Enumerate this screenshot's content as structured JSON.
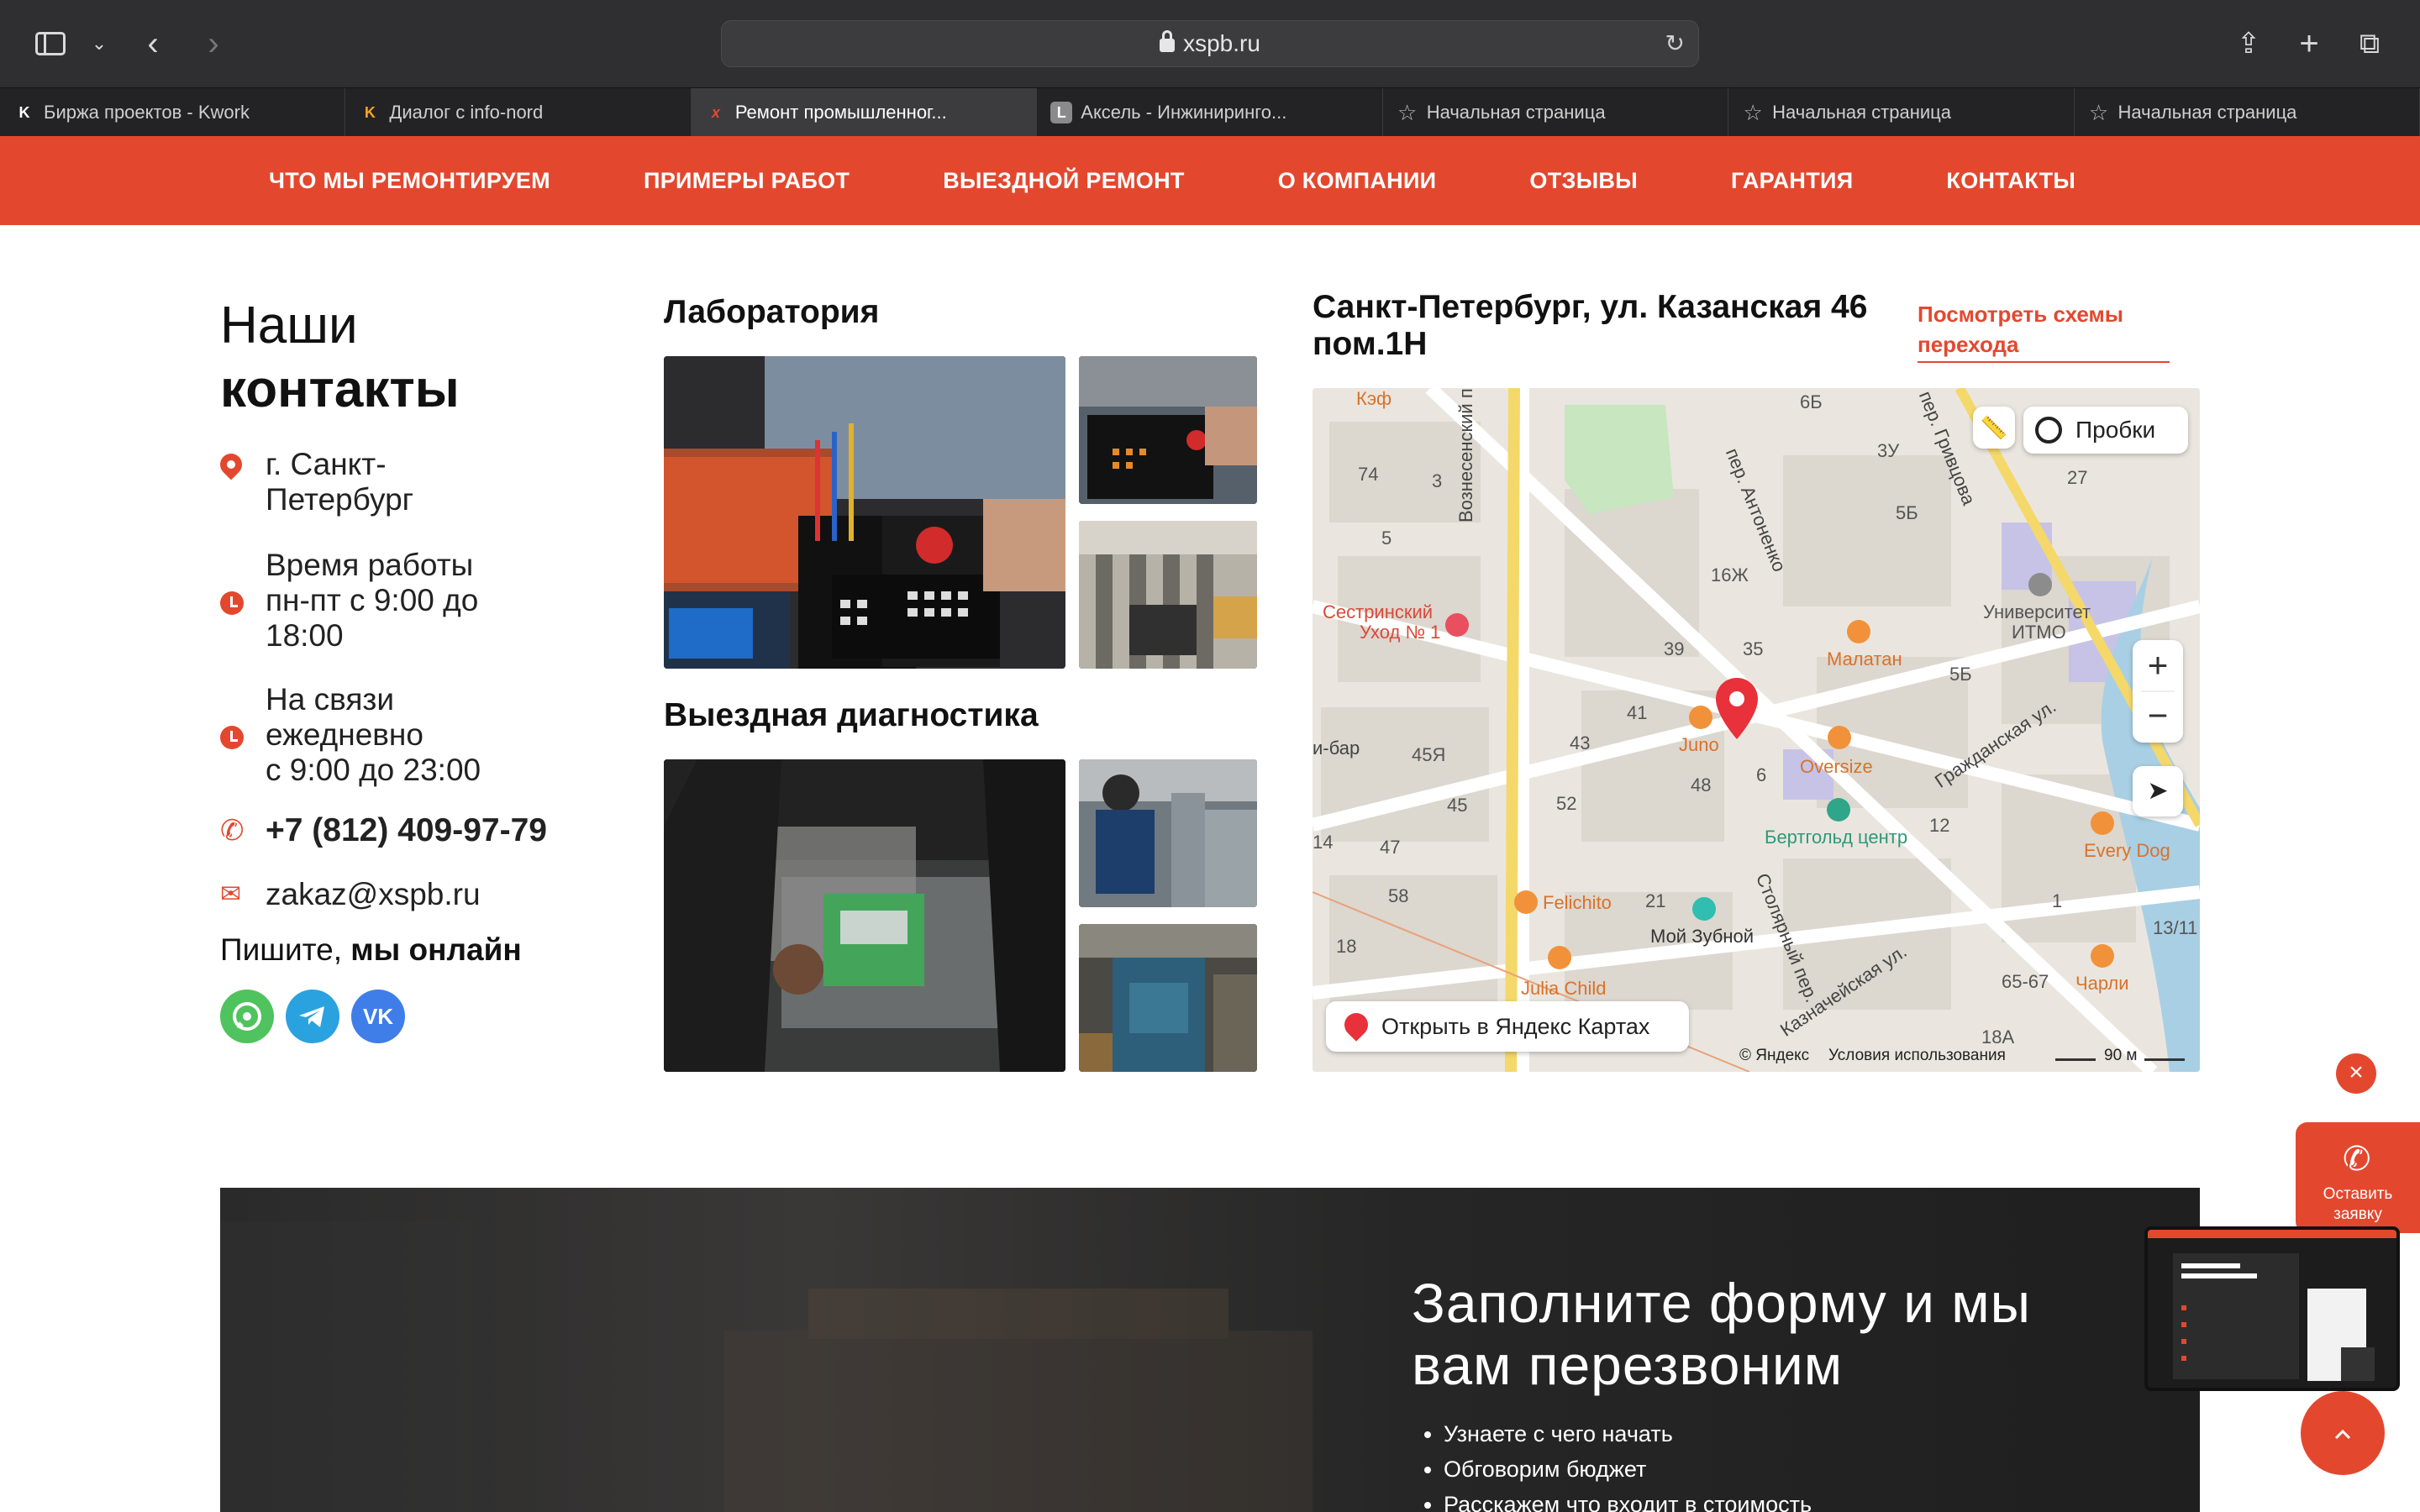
{
  "browser": {
    "url": "xspb.ru",
    "tabs": [
      {
        "label": "Биржа проектов - Kwork",
        "fav": "K"
      },
      {
        "label": "Диалог с info-nord",
        "fav": "K"
      },
      {
        "label": "Ремонт промышленног...",
        "fav": "x"
      },
      {
        "label": "Аксель - Инжиниринго...",
        "fav": "L"
      },
      {
        "label": "Начальная страница",
        "fav": "☆"
      },
      {
        "label": "Начальная страница",
        "fav": "☆"
      },
      {
        "label": "Начальная страница",
        "fav": "☆"
      }
    ]
  },
  "nav": [
    "ЧТО МЫ РЕМОНТИРУЕМ",
    "ПРИМЕРЫ РАБОТ",
    "ВЫЕЗДНОЙ РЕМОНТ",
    "О КОМПАНИИ",
    "ОТЗЫВЫ",
    "ГАРАНТИЯ",
    "КОНТАКТЫ"
  ],
  "contacts": {
    "title_light": "Наши",
    "title_bold": "контакты",
    "city": "г. Санкт-Петербург",
    "hours_title": "Время работы",
    "hours": "пн-пт с 9:00 до 18:00",
    "online_title": "На связи ежедневно",
    "online_hours": "с 9:00 до 23:00",
    "phone": "+7 (812) 409-97-79",
    "email": "zakaz@xspb.ru",
    "write_light": "Пишите,",
    "write_bold": "мы онлайн"
  },
  "gallery": {
    "lab_title": "Лаборатория",
    "field_title": "Выездная диагностика"
  },
  "map": {
    "address": "Санкт-Петербург, ул. Казанская 46 пом.1Н",
    "schemes_link": "Посмотреть схемы перехода",
    "traffic": "Пробки",
    "open_yandex": "Открыть в Яндекс Картах",
    "copyright": "© Яндекс",
    "terms": "Условия использования",
    "scale": "90 м",
    "labels": {
      "kef": "Кэф",
      "sestr": "Сестринский",
      "uhod": "Уход № 1",
      "vozn": "Вознесенский просп.",
      "antonenko": "пер. Антоненко",
      "grivcova": "пер. Гривцова",
      "univer": "Университет",
      "itmo": "ИТМО",
      "malatan": "Малатан",
      "juno": "Juno",
      "oversize": "Oversize",
      "bertgold": "Бертгольд центр",
      "everydog": "Every Dog",
      "felichito": "Felichito",
      "zubnoy": "Мой Зубной",
      "julia": "Julia Child",
      "charli": "Чарли",
      "grazhd": "Гражданская ул.",
      "stolyar": "Столярный пер.",
      "kaznach": "Казначейская ул.",
      "bar": "и-бар",
      "n16": "16Ж",
      "n35": "35",
      "n39": "39",
      "n41": "41",
      "n43": "43",
      "n48": "48",
      "n52": "52",
      "n45": "45",
      "n47": "47",
      "n459": "45Я",
      "n58": "58",
      "n21": "21",
      "n14": "14",
      "n18": "18",
      "n6": "6",
      "n5b": "5Б",
      "n1": "1",
      "n13": "13/11",
      "n65": "65-67",
      "n18a": "18А",
      "n74": "74",
      "n3": "3",
      "n5": "5",
      "n27": "27",
      "n3u": "3У",
      "n6b": "6Б",
      "n5b2": "5Б",
      "n12": "12"
    }
  },
  "form": {
    "title": "Заполните форму и мы вам перезвоним",
    "bullets": [
      "Узнаете с чего начать",
      "Обговорим бюджет",
      "Расскажем что входит в стоимость"
    ]
  },
  "float": {
    "close": "×",
    "call": "Оставить заявку",
    "up": "⌃"
  },
  "colors": {
    "accent": "#e3482f",
    "whatsapp": "#4fc35d",
    "telegram": "#2aa2e0",
    "vk": "#3f7ee8"
  }
}
